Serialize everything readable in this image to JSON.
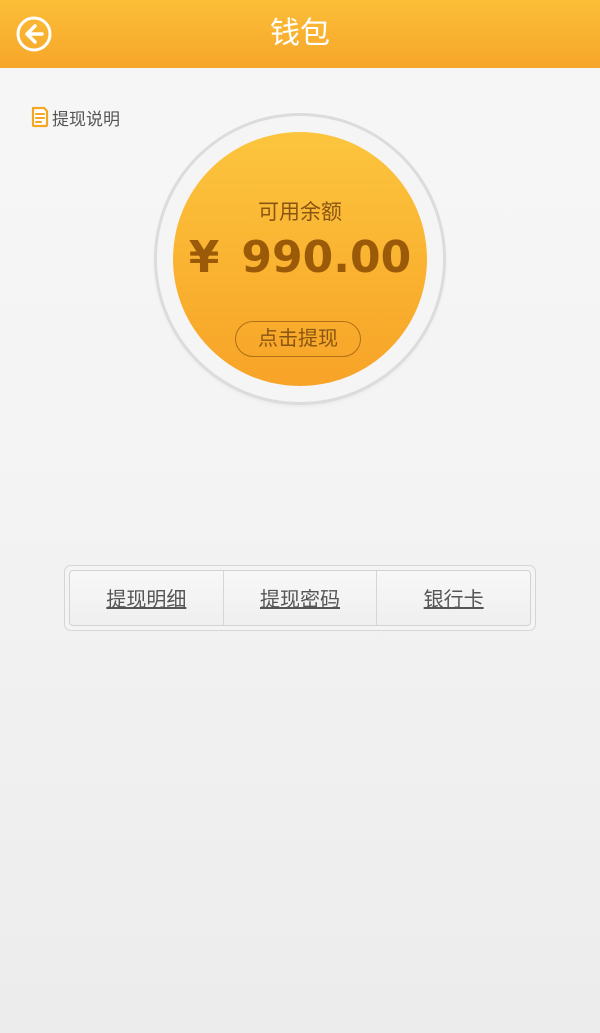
{
  "header": {
    "title": "钱包",
    "back_icon": "back-arrow-icon"
  },
  "withdraw_info": {
    "label": "提现说明",
    "icon": "document-icon"
  },
  "balance": {
    "label": "可用余额",
    "currency": "¥",
    "amount": "990.00",
    "withdraw_button": "点击提现"
  },
  "tabs": [
    {
      "label": "提现明细"
    },
    {
      "label": "提现密码"
    },
    {
      "label": "银行卡"
    }
  ],
  "colors": {
    "accent": "#f9ad2d",
    "header": "#f7a62a",
    "balance_text": "#9a5a08"
  }
}
